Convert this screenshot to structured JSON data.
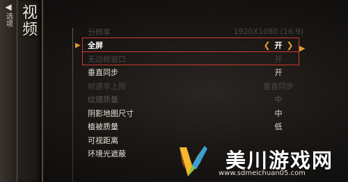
{
  "header": {
    "back_label": "选项",
    "section_title": "视频"
  },
  "settings": [
    {
      "label": "分辨率",
      "value": "1920X1080 (16:9)",
      "state": "dim"
    },
    {
      "label": "全屏",
      "value": "开",
      "state": "selected"
    },
    {
      "label": "无边框窗口",
      "value": "开",
      "state": "dim"
    },
    {
      "label": "垂直同步",
      "value": "开",
      "state": "normal"
    },
    {
      "label": "帧速率上限",
      "value": "垂直同步",
      "state": "dim"
    },
    {
      "label": "纹理质量",
      "value": "中",
      "state": "faint"
    },
    {
      "label": "阴影地图尺寸",
      "value": "中",
      "state": "normal"
    },
    {
      "label": "植被质量",
      "value": "低",
      "state": "normal"
    },
    {
      "label": "可视距离",
      "value": "",
      "state": "normal"
    },
    {
      "label": "环境光遮蔽",
      "value": "",
      "state": "normal"
    }
  ],
  "colors": {
    "accent": "#e09a2e",
    "highlight_box": "#d23a2e"
  },
  "watermark": {
    "title": "美川游戏网",
    "url": "www.sdmeichuan05.com"
  }
}
